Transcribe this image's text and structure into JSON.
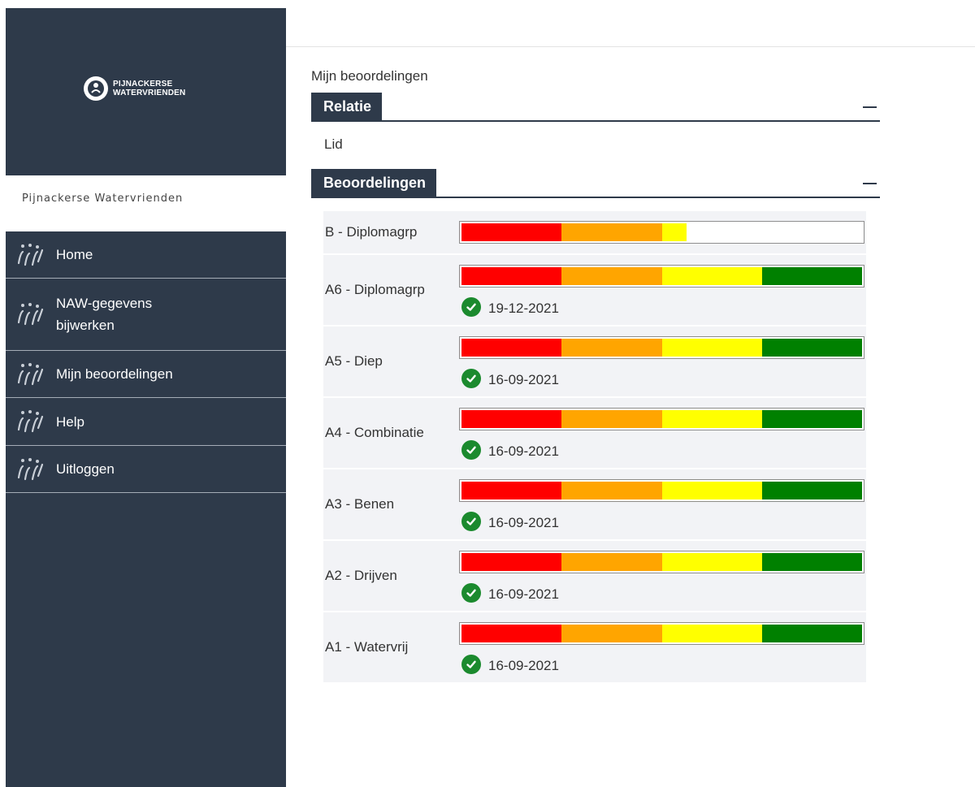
{
  "sidebar": {
    "logo_text": [
      "PIJNACKERSE",
      "WATERVRIENDEN"
    ],
    "org_name": "Pijnackerse Watervrienden",
    "menu": [
      {
        "label": "Home",
        "icon": "swimmers-icon"
      },
      {
        "label": "NAW-gegevens bijwerken",
        "icon": "swimmers-icon"
      },
      {
        "label": "Mijn beoordelingen",
        "icon": "swimmers-icon"
      },
      {
        "label": "Help",
        "icon": "swimmers-icon"
      },
      {
        "label": "Uitloggen",
        "icon": "swimmers-icon"
      }
    ]
  },
  "main": {
    "breadcrumb": "Mijn beoordelingen",
    "relatie": {
      "title": "Relatie",
      "value": "Lid"
    },
    "beoordelingen": {
      "title": "Beoordelingen",
      "items": [
        {
          "label": "B - Diplomagrp",
          "progress_segments": 2.25,
          "completed": false,
          "date": null
        },
        {
          "label": "A6 - Diplomagrp",
          "progress_segments": 4,
          "completed": true,
          "date": "19-12-2021"
        },
        {
          "label": "A5 - Diep",
          "progress_segments": 4,
          "completed": true,
          "date": "16-09-2021"
        },
        {
          "label": "A4 - Combinatie",
          "progress_segments": 4,
          "completed": true,
          "date": "16-09-2021"
        },
        {
          "label": "A3 - Benen",
          "progress_segments": 4,
          "completed": true,
          "date": "16-09-2021"
        },
        {
          "label": "A2 - Drijven",
          "progress_segments": 4,
          "completed": true,
          "date": "16-09-2021"
        },
        {
          "label": "A1 - Watervrij",
          "progress_segments": 4,
          "completed": true,
          "date": "16-09-2021"
        }
      ]
    },
    "segment_colors": [
      "#ff0000",
      "#ffa500",
      "#ffff00",
      "#008000"
    ],
    "check_color": "#1b8a2e",
    "sidebar_color": "#2e3a4a"
  }
}
